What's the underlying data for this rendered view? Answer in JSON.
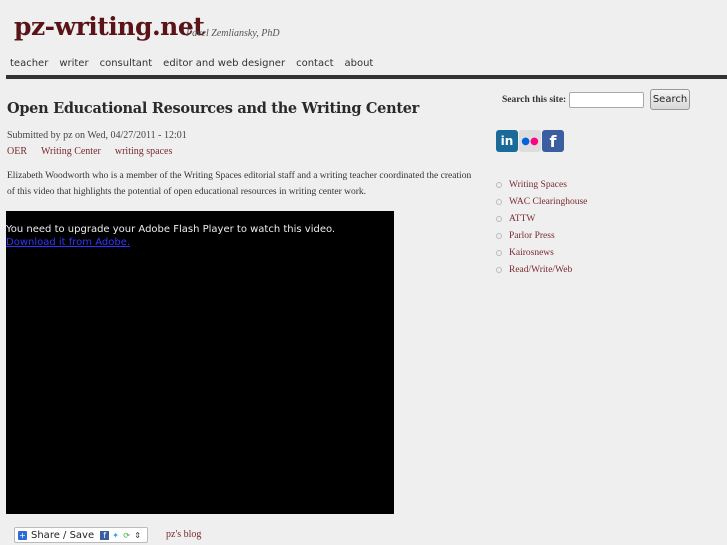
{
  "header": {
    "site_name": "pz-writing.net",
    "slogan": "Pavel Zemliansky, PhD",
    "nav": [
      "teacher",
      "writer",
      "consultant",
      "editor and web designer",
      "contact",
      "about"
    ]
  },
  "node": {
    "title": "Open Educational Resources and the Writing Center",
    "submitted": "Submitted by pz on Wed, 04/27/2011 - 12:01",
    "terms": [
      "OER",
      "Writing Center",
      "writing spaces"
    ],
    "body": "Elizabeth Woodworth who is a member of the Writing Spaces editorial staff and a writing teacher coordinated the creation of this video that highlights the potential of open educational resources in writing center work.",
    "video": {
      "message": "You need to upgrade your Adobe Flash Player to watch this video.",
      "download_link": "Download it from Adobe."
    },
    "share_label": "Share / Save",
    "blog_link": "pz's blog"
  },
  "sidebar": {
    "search_label": "Search this site:",
    "search_value": "",
    "search_button": "Search",
    "social": [
      "in",
      "••",
      "f"
    ],
    "links": [
      "Writing Spaces",
      "WAC Clearinghouse",
      "ATTW",
      "Parlor Press",
      "Kairosnews",
      "Read/Write/Web"
    ]
  }
}
